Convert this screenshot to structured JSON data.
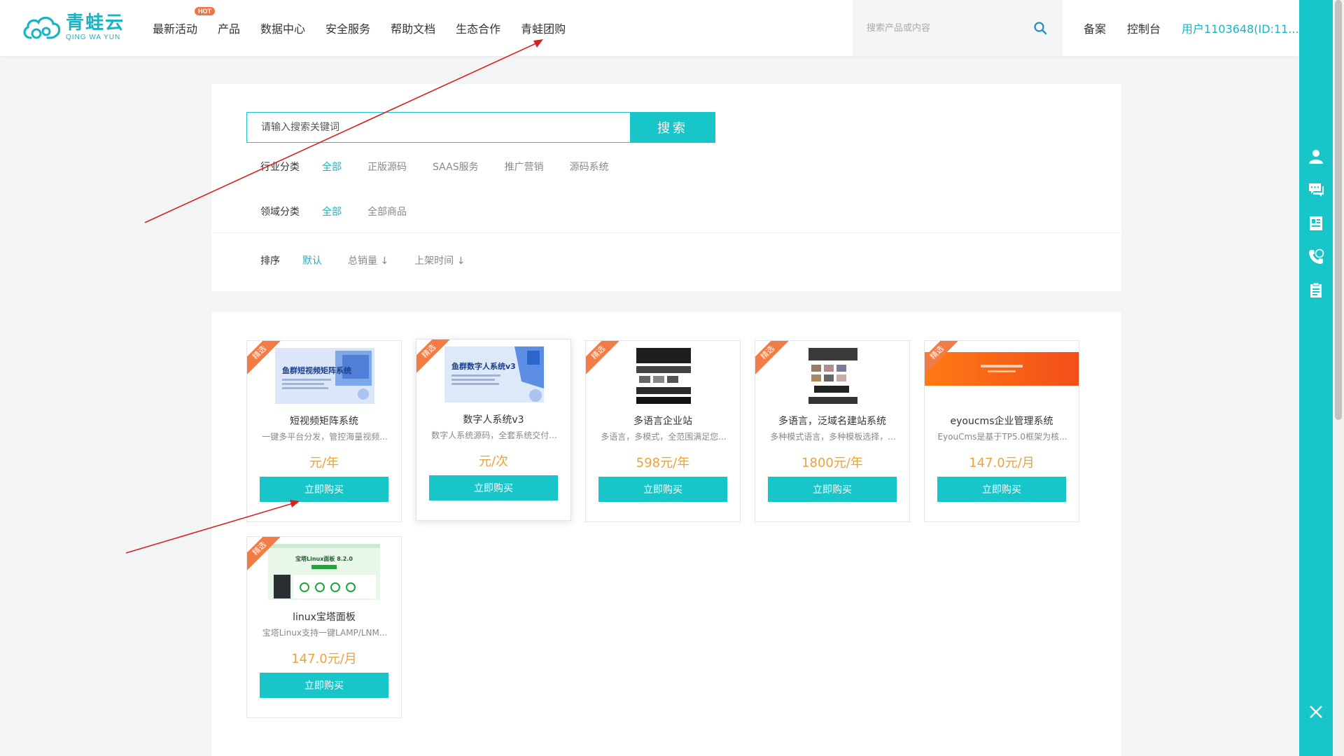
{
  "header": {
    "logo_cn": "青蛙云",
    "logo_en": "QING WA YUN",
    "nav": [
      "最新活动",
      "产品",
      "数据中心",
      "安全服务",
      "帮助文档",
      "生态合作",
      "青蛙团购"
    ],
    "hot_badge": "HOT",
    "search_placeholder": "搜索产品或内容",
    "links": [
      "备案",
      "控制台"
    ],
    "user": "用户1103648(ID:11..."
  },
  "filters": {
    "search_placeholder": "请输入搜索关键词",
    "search_button": "搜索",
    "industry_label": "行业分类",
    "industry_options": [
      "全部",
      "正版源码",
      "SAAS服务",
      "推广营销",
      "源码系统"
    ],
    "domain_label": "领域分类",
    "domain_options": [
      "全部",
      "全部商品"
    ],
    "sort_label": "排序",
    "sort_options": [
      "默认",
      "总销量 ↓",
      "上架时间 ↓"
    ]
  },
  "products": [
    {
      "badge": "精选",
      "thumb_text": "鱼群短视频矩阵系统",
      "title": "短视频矩阵系统",
      "desc": "一键多平台分发，管控海量视频...",
      "price": "元/年",
      "button": "立即购买"
    },
    {
      "badge": "精选",
      "thumb_text": "鱼群数字人系统v3",
      "title": "数字人系统v3",
      "desc": "数字人系统源码，全套系统交付...",
      "price": "元/次",
      "button": "立即购买"
    },
    {
      "badge": "精选",
      "title": "多语言企业站",
      "desc": "多语言，多模式，全范围满足您...",
      "price": "598元/年",
      "button": "立即购买"
    },
    {
      "badge": "精选",
      "title": "多语言，泛域名建站系统",
      "desc": "多种模式语言，多种模板选择，...",
      "price": "1800元/年",
      "button": "立即购买"
    },
    {
      "badge": "精选",
      "title": "eyoucms企业管理系统",
      "desc": "EyouCms是基于TP5.0框架为核...",
      "price": "147.0元/月",
      "button": "立即购买"
    },
    {
      "badge": "精选",
      "thumb_text": "宝塔Linux面板 8.2.0",
      "title": "linux宝塔面板",
      "desc": "宝塔Linux支持一键LAMP/LNM...",
      "price": "147.0元/月",
      "button": "立即购买"
    }
  ],
  "colors": {
    "accent": "#18c5c9",
    "price": "#e8a33d",
    "ribbon": "#f17c45",
    "annotation": "#d9211e"
  },
  "sidebar_icons": [
    "user-icon",
    "chat-icon",
    "document-icon",
    "phone-24-icon",
    "clipboard-icon",
    "close-icon"
  ]
}
